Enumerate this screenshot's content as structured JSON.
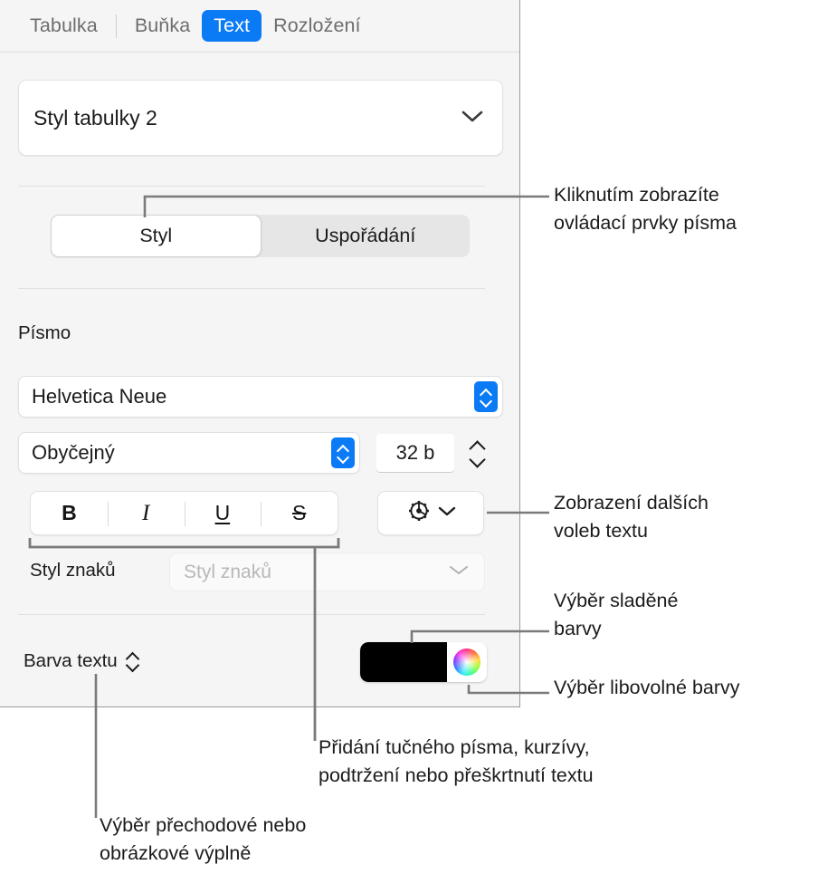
{
  "inspector": {
    "tabs": [
      {
        "label": "Tabulka",
        "active": false
      },
      {
        "label": "Buňka",
        "active": false
      },
      {
        "label": "Text",
        "active": true
      },
      {
        "label": "Rozložení",
        "active": false
      }
    ],
    "table_style": {
      "value": "Styl tabulky 2",
      "chevron": "chevron-down-icon"
    },
    "segmented": {
      "options": [
        "Styl",
        "Uspořádání"
      ],
      "selected": "Styl"
    },
    "font_section": {
      "heading": "Písmo",
      "family": "Helvetica Neue",
      "style": "Obyčejný",
      "size": "32 b"
    },
    "format_buttons": [
      {
        "name": "bold",
        "glyph": "B"
      },
      {
        "name": "italic",
        "glyph": "I"
      },
      {
        "name": "underline",
        "glyph": "U"
      },
      {
        "name": "strikethrough",
        "glyph": "S"
      }
    ],
    "gear_button": {
      "icon": "gear-icon",
      "chevron": "chevron-down-icon"
    },
    "character_style": {
      "label": "Styl znaků",
      "placeholder": "Styl znaků",
      "value": ""
    },
    "text_color": {
      "label": "Barva textu",
      "swatch_color": "#000000",
      "wheel_icon": "color-wheel-icon"
    }
  },
  "callouts": {
    "style_controls": "Kliknutím zobrazíte\novládací prvky písma",
    "more_text_options": "Zobrazení dalších\nvoleb textu",
    "matched_color": "Výběr sladěné\nbarvy",
    "any_color": "Výběr libovolné barvy",
    "bius": "Přidání tučného písma, kurzívy,\npodtržení nebo přeškrtnutí textu",
    "gradient_fill": "Výběr přechodové nebo\nobrázkové výplně"
  },
  "colors": {
    "accent": "#0b7bf5",
    "panel_bg": "#f5f5f5",
    "callout_line": "#7a7a7a"
  }
}
